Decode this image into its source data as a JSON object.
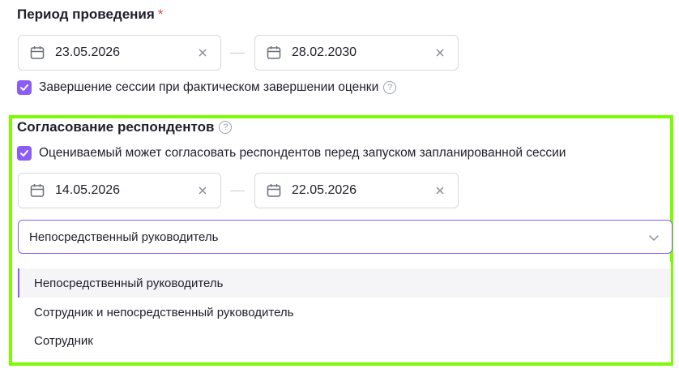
{
  "period": {
    "title": "Период проведения",
    "required_mark": "*",
    "start_date": "23.05.2026",
    "end_date": "28.02.2030",
    "checkbox_label": "Завершение сессии при фактическом завершении оценки",
    "checked": true
  },
  "approval": {
    "title": "Согласование респондентов",
    "checkbox_label": "Оцениваемый может согласовать респондентов перед запуском запланированной сессии",
    "checked": true,
    "start_date": "14.05.2026",
    "end_date": "22.05.2026",
    "select_value": "Непосредственный руководитель",
    "options": [
      {
        "label": "Непосредственный руководитель",
        "selected": true
      },
      {
        "label": "Сотрудник и непосредственный руководитель",
        "selected": false
      },
      {
        "label": "Сотрудник",
        "selected": false
      }
    ]
  },
  "help_glyph": "?",
  "colors": {
    "accent": "#8b5cf6",
    "highlight": "#7cfc00",
    "required": "#e5484d"
  }
}
